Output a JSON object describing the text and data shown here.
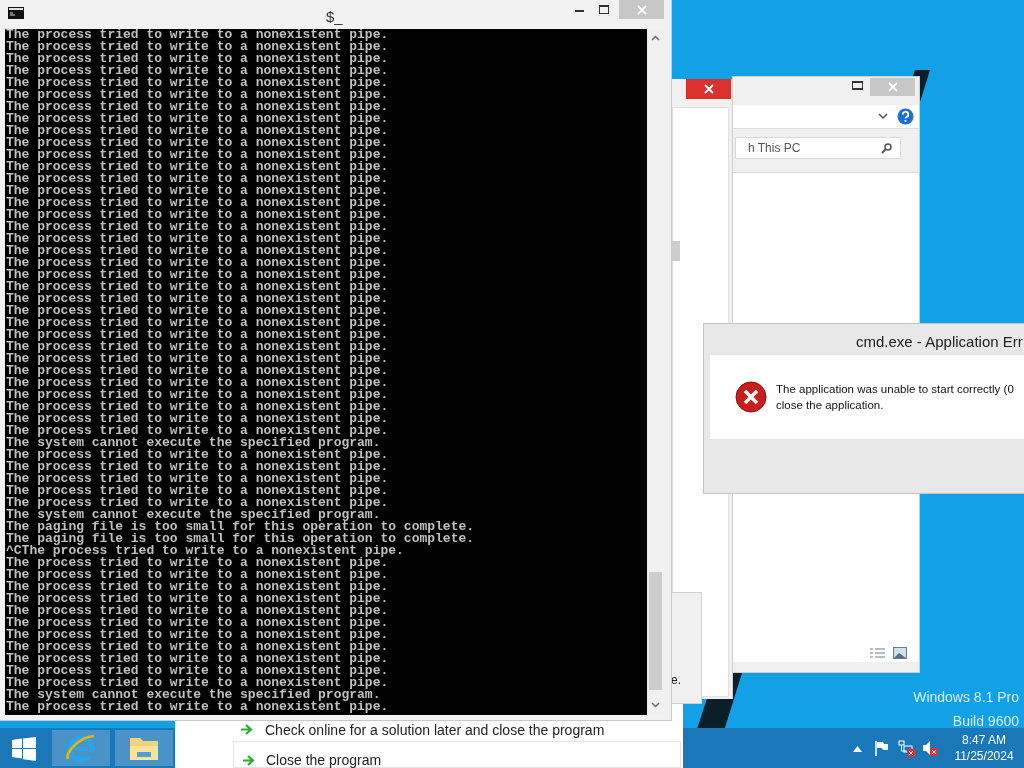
{
  "console": {
    "title": "$_",
    "lines": [
      "The process tried to write to a nonexistent pipe.",
      "The process tried to write to a nonexistent pipe.",
      "The process tried to write to a nonexistent pipe.",
      "The process tried to write to a nonexistent pipe.",
      "The process tried to write to a nonexistent pipe.",
      "The process tried to write to a nonexistent pipe.",
      "The process tried to write to a nonexistent pipe.",
      "The process tried to write to a nonexistent pipe.",
      "The process tried to write to a nonexistent pipe.",
      "The process tried to write to a nonexistent pipe.",
      "The process tried to write to a nonexistent pipe.",
      "The process tried to write to a nonexistent pipe.",
      "The process tried to write to a nonexistent pipe.",
      "The process tried to write to a nonexistent pipe.",
      "The process tried to write to a nonexistent pipe.",
      "The process tried to write to a nonexistent pipe.",
      "The process tried to write to a nonexistent pipe.",
      "The process tried to write to a nonexistent pipe.",
      "The process tried to write to a nonexistent pipe.",
      "The process tried to write to a nonexistent pipe.",
      "The process tried to write to a nonexistent pipe.",
      "The process tried to write to a nonexistent pipe.",
      "The process tried to write to a nonexistent pipe.",
      "The process tried to write to a nonexistent pipe.",
      "The process tried to write to a nonexistent pipe.",
      "The process tried to write to a nonexistent pipe.",
      "The process tried to write to a nonexistent pipe.",
      "The process tried to write to a nonexistent pipe.",
      "The process tried to write to a nonexistent pipe.",
      "The process tried to write to a nonexistent pipe.",
      "The process tried to write to a nonexistent pipe.",
      "The process tried to write to a nonexistent pipe.",
      "The process tried to write to a nonexistent pipe.",
      "The process tried to write to a nonexistent pipe.",
      "The system cannot execute the specified program.",
      "The process tried to write to a nonexistent pipe.",
      "The process tried to write to a nonexistent pipe.",
      "The process tried to write to a nonexistent pipe.",
      "The process tried to write to a nonexistent pipe.",
      "The process tried to write to a nonexistent pipe.",
      "The system cannot execute the specified program.",
      "The paging file is too small for this operation to complete.",
      "The paging file is too small for this operation to complete.",
      "^CThe process tried to write to a nonexistent pipe.",
      "The process tried to write to a nonexistent pipe.",
      "The process tried to write to a nonexistent pipe.",
      "The process tried to write to a nonexistent pipe.",
      "The process tried to write to a nonexistent pipe.",
      "The process tried to write to a nonexistent pipe.",
      "The process tried to write to a nonexistent pipe.",
      "The process tried to write to a nonexistent pipe.",
      "The process tried to write to a nonexistent pipe.",
      "The process tried to write to a nonexistent pipe.",
      "The process tried to write to a nonexistent pipe.",
      "The process tried to write to a nonexistent pipe.",
      "The system cannot execute the specified program.",
      "The process tried to write to a nonexistent pipe."
    ]
  },
  "explorer": {
    "search_placeholder": "h This PC"
  },
  "background_window": {
    "fragment": "e.",
    "options": [
      "Check online for a solution later and close the program",
      "Close the program"
    ]
  },
  "error_dialog": {
    "title": "cmd.exe - Application Err",
    "message": [
      "The application was unable to start correctly (0",
      "close the application."
    ]
  },
  "watermark": [
    "Windows 8.1 Pro",
    "Build 9600"
  ],
  "taskbar": {
    "time": "8:47 AM",
    "date": "11/25/2024"
  }
}
